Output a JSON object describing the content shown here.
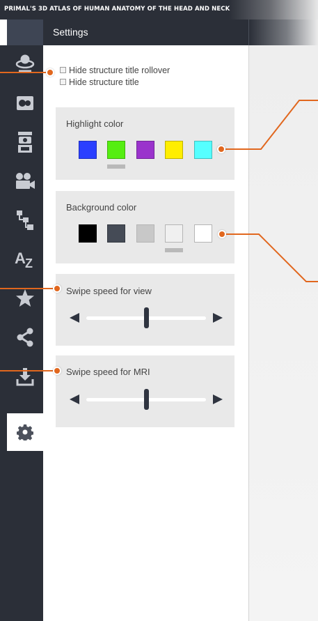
{
  "app": {
    "title": "PRIMAL'S 3D ATLAS OF HUMAN ANATOMY OF THE HEAD AND NECK"
  },
  "panel": {
    "heading": "Settings"
  },
  "sidebar": {
    "items": [
      {
        "name": "rotate-view",
        "icon": "rotate-3d-icon"
      },
      {
        "name": "mri-views",
        "icon": "mri-slides-icon"
      },
      {
        "name": "layers",
        "icon": "layers-stack-icon"
      },
      {
        "name": "movies",
        "icon": "movie-camera-icon"
      },
      {
        "name": "hierarchy",
        "icon": "tree-hierarchy-icon"
      },
      {
        "name": "a-to-z",
        "icon": "a-z-index-icon"
      },
      {
        "name": "favorites",
        "icon": "star-icon"
      },
      {
        "name": "share",
        "icon": "share-icon"
      },
      {
        "name": "download",
        "icon": "download-icon"
      },
      {
        "name": "settings",
        "icon": "gear-icon",
        "active": true
      }
    ]
  },
  "options": {
    "hide_title_rollover": {
      "label": "Hide structure title rollover",
      "checked": false
    },
    "hide_title": {
      "label": "Hide structure title",
      "checked": false
    }
  },
  "highlight": {
    "label": "Highlight color",
    "colors": [
      "#2a3fff",
      "#55ee11",
      "#9a33cc",
      "#ffee00",
      "#55ffff"
    ],
    "selected_index": 1
  },
  "background": {
    "label": "Background color",
    "colors": [
      "#000000",
      "#454b56",
      "#c8c8c8",
      "#f0f0f0",
      "#ffffff"
    ],
    "selected_index": 3
  },
  "swipe_view": {
    "label": "Swipe speed for view",
    "value_fraction": 0.5
  },
  "swipe_mri": {
    "label": "Swipe speed for MRI",
    "value_fraction": 0.5
  },
  "accent_color": "#e1671e"
}
